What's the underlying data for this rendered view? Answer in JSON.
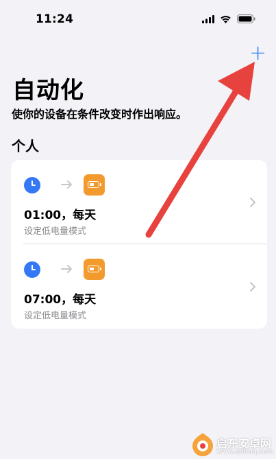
{
  "status_bar": {
    "time": "11:24",
    "icons": [
      "signal-icon",
      "wifi-icon",
      "battery-icon"
    ]
  },
  "header": {
    "add_label": "+",
    "title": "自动化",
    "subtitle": "使你的设备在条件改变时作出响应。"
  },
  "section": {
    "title": "个人"
  },
  "automations": [
    {
      "trigger_icon": "clock-icon",
      "action_icon": "low-power-battery-icon",
      "time": "01:00，每天",
      "description": "设定低电量模式"
    },
    {
      "trigger_icon": "clock-icon",
      "action_icon": "low-power-battery-icon",
      "time": "07:00，每天",
      "description": "设定低电量模式"
    }
  ],
  "watermark": {
    "title": "启东安卓网",
    "url": "www.qdltdq.com"
  },
  "colors": {
    "background": "#f2f2f7",
    "accent_blue": "#2f7bf6",
    "clock_blue": "#3478f6",
    "action_orange": "#f39a2e",
    "annotation_red": "#e8423f",
    "secondary_text": "#8a8a8e"
  }
}
